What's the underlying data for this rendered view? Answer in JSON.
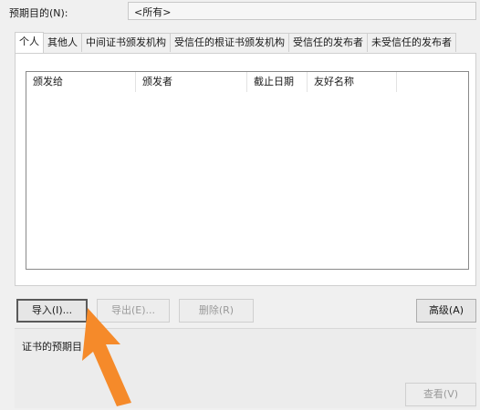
{
  "purpose": {
    "label": "预期目的(N):",
    "value": "<所有>"
  },
  "tabs": [
    {
      "label": "个人",
      "active": true
    },
    {
      "label": "其他人",
      "active": false
    },
    {
      "label": "中间证书颁发机构",
      "active": false
    },
    {
      "label": "受信任的根证书颁发机构",
      "active": false
    },
    {
      "label": "受信任的发布者",
      "active": false
    },
    {
      "label": "未受信任的发布者",
      "active": false
    }
  ],
  "columns": [
    "颁发给",
    "颁发者",
    "截止日期",
    "友好名称"
  ],
  "buttons": {
    "import": "导入(I)...",
    "export": "导出(E)...",
    "delete": "删除(R)",
    "advanced": "高级(A)",
    "view": "查看(V)"
  },
  "purpose_group": {
    "label": "证书的预期目"
  },
  "colors": {
    "arrow": "#f58a2a"
  }
}
